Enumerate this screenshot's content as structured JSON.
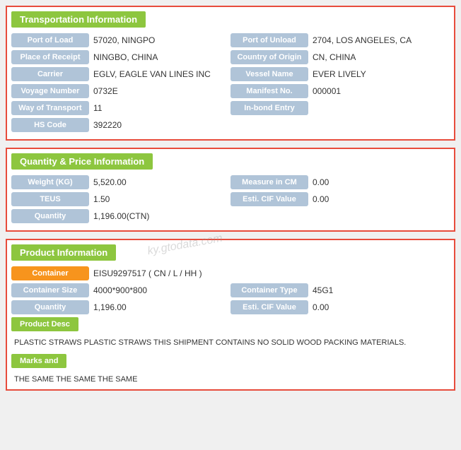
{
  "transportation": {
    "header": "Transportation Information",
    "fields": {
      "port_of_load_label": "Port of Load",
      "port_of_load_value": "57020, NINGPO",
      "port_of_unload_label": "Port of Unload",
      "port_of_unload_value": "2704, LOS ANGELES, CA",
      "place_of_receipt_label": "Place of Receipt",
      "place_of_receipt_value": "NINGBO, CHINA",
      "country_of_origin_label": "Country of Origin",
      "country_of_origin_value": "CN, CHINA",
      "carrier_label": "Carrier",
      "carrier_value": "EGLV, EAGLE VAN LINES INC",
      "vessel_name_label": "Vessel Name",
      "vessel_name_value": "EVER LIVELY",
      "voyage_number_label": "Voyage Number",
      "voyage_number_value": "0732E",
      "manifest_no_label": "Manifest No.",
      "manifest_no_value": "000001",
      "way_of_transport_label": "Way of Transport",
      "way_of_transport_value": "11",
      "in_bond_entry_label": "In-bond Entry",
      "in_bond_entry_value": "",
      "hs_code_label": "HS Code",
      "hs_code_value": "392220"
    }
  },
  "quantity_price": {
    "header": "Quantity & Price Information",
    "fields": {
      "weight_label": "Weight (KG)",
      "weight_value": "5,520.00",
      "measure_in_cm_label": "Measure in CM",
      "measure_in_cm_value": "0.00",
      "teus_label": "TEUS",
      "teus_value": "1.50",
      "esti_cif_value_label": "Esti. CIF Value",
      "esti_cif_value_value": "0.00",
      "quantity_label": "Quantity",
      "quantity_value": "1,196.00(CTN)"
    }
  },
  "product": {
    "header": "Product Information",
    "container_label": "Container",
    "container_value": "EISU9297517 ( CN / L / HH )",
    "container_size_label": "Container Size",
    "container_size_value": "4000*900*800",
    "container_type_label": "Container Type",
    "container_type_value": "45G1",
    "quantity_label": "Quantity",
    "quantity_value": "1,196.00",
    "esti_cif_label": "Esti. CIF Value",
    "esti_cif_value": "0.00",
    "product_desc_header": "Product Desc",
    "product_desc_text": "PLASTIC STRAWS PLASTIC STRAWS THIS SHIPMENT CONTAINS NO SOLID WOOD PACKING MATERIALS.",
    "marks_header": "Marks and",
    "marks_text": "THE SAME THE SAME THE SAME"
  },
  "watermark": "ky.gtodata.com"
}
